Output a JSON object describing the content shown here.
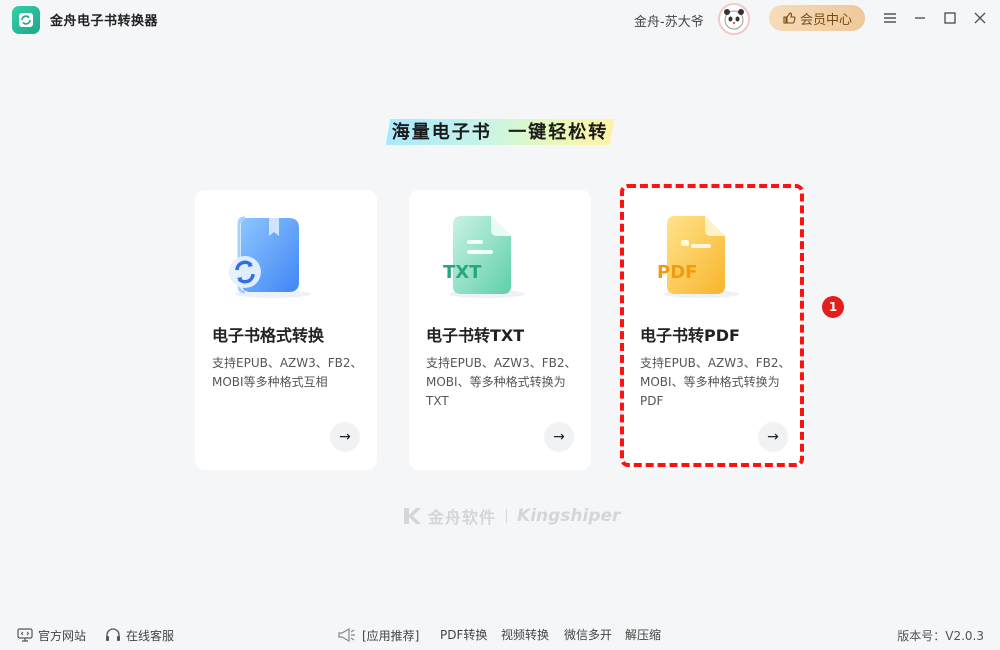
{
  "app": {
    "title": "金舟电子书转换器",
    "username": "金舟-苏大爷",
    "vip_label": "会员中心"
  },
  "slogan": "海量电子书  一键轻松转",
  "cards": [
    {
      "title": "电子书格式转换",
      "desc": "支持EPUB、AZW3、FB2、MOBI等多种格式互相",
      "arrow": "→",
      "icon_text": ""
    },
    {
      "title": "电子书转TXT",
      "desc": "支持EPUB、AZW3、FB2、MOBI、等多种格式转换为TXT",
      "arrow": "→",
      "icon_text": "TXT"
    },
    {
      "title": "电子书转PDF",
      "desc": "支持EPUB、AZW3、FB2、MOBI、等多种格式转换为PDF",
      "arrow": "→",
      "icon_text": "PDF"
    }
  ],
  "annotation": {
    "step_number": "1"
  },
  "brand": {
    "cn": "金舟软件",
    "en": "Kingshiper"
  },
  "footer": {
    "website": "官方网站",
    "support": "在线客服",
    "recommend": "[应用推荐]",
    "links": [
      "PDF转换",
      "视频转换",
      "微信多开",
      "解压缩"
    ],
    "version": "版本号：V2.0.3"
  },
  "colors": {
    "accent_green": "#1ea58a",
    "highlight_red": "#ff1111",
    "vip_gold": "#eec89a"
  }
}
